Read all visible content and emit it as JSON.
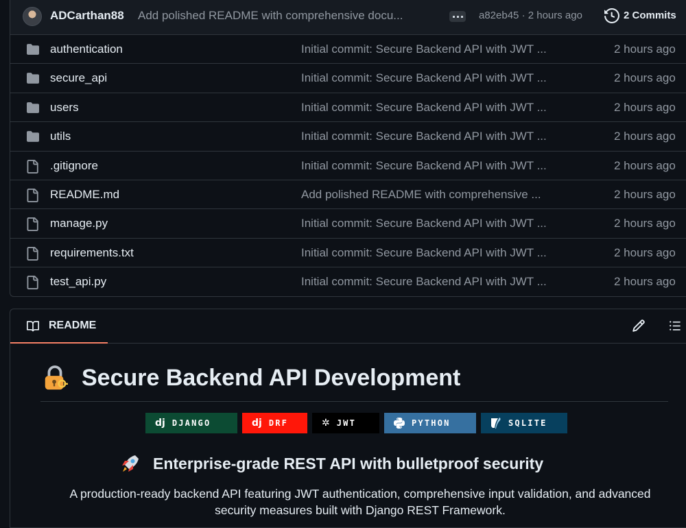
{
  "commit": {
    "author": "ADCarthan88",
    "message": "Add polished README with comprehensive docu...",
    "hash_time": "a82eb45 · 2 hours ago",
    "commits_label": "2 Commits"
  },
  "files": [
    {
      "type": "folder",
      "name": "authentication",
      "message": "Initial commit: Secure Backend API with JWT ...",
      "time": "2 hours ago"
    },
    {
      "type": "folder",
      "name": "secure_api",
      "message": "Initial commit: Secure Backend API with JWT ...",
      "time": "2 hours ago"
    },
    {
      "type": "folder",
      "name": "users",
      "message": "Initial commit: Secure Backend API with JWT ...",
      "time": "2 hours ago"
    },
    {
      "type": "folder",
      "name": "utils",
      "message": "Initial commit: Secure Backend API with JWT ...",
      "time": "2 hours ago"
    },
    {
      "type": "file",
      "name": ".gitignore",
      "message": "Initial commit: Secure Backend API with JWT ...",
      "time": "2 hours ago"
    },
    {
      "type": "file",
      "name": "README.md",
      "message": "Add polished README with comprehensive ...",
      "time": "2 hours ago"
    },
    {
      "type": "file",
      "name": "manage.py",
      "message": "Initial commit: Secure Backend API with JWT ...",
      "time": "2 hours ago"
    },
    {
      "type": "file",
      "name": "requirements.txt",
      "message": "Initial commit: Secure Backend API with JWT ...",
      "time": "2 hours ago"
    },
    {
      "type": "file",
      "name": "test_api.py",
      "message": "Initial commit: Secure Backend API with JWT ...",
      "time": "2 hours ago"
    }
  ],
  "readme": {
    "tab_label": "README",
    "title": "Secure Backend API Development",
    "title_emoji": "lock-with-key-icon",
    "badges": [
      {
        "logo": "dj",
        "label": "DJANGO",
        "color": "#0c4b33"
      },
      {
        "logo": "dj",
        "label": "DRF",
        "color": "#ff1709"
      },
      {
        "logo": "✲",
        "label": "JWT",
        "color": "#000000"
      },
      {
        "logo": "python-logo",
        "label": "PYTHON",
        "color": "#3670a0"
      },
      {
        "logo": "sqlite-logo",
        "label": "SQLITE",
        "color": "#07405e"
      }
    ],
    "subtitle": "Enterprise-grade REST API with bulletproof security",
    "subtitle_emoji": "rocket-icon",
    "paragraph": "A production-ready backend API featuring JWT authentication, comprehensive input validation, and advanced security measures built with Django REST Framework."
  },
  "colors": {
    "background": "#0d1117",
    "border": "#30363d",
    "muted_text": "#9198a1",
    "tab_underline": "#f78166",
    "folder_icon": "#9198a1"
  }
}
